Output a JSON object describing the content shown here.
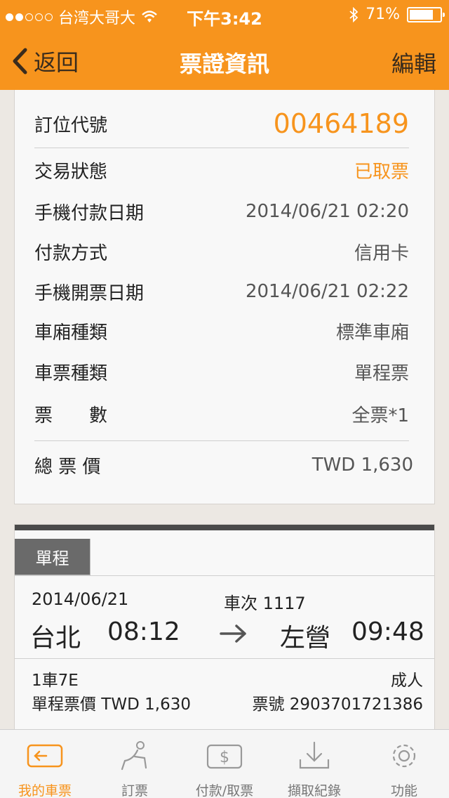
{
  "status_bar": {
    "carrier": "台湾大哥大",
    "time": "下午3:42",
    "battery": "71%",
    "battery_level": 0.71
  },
  "nav": {
    "back_label": "返回",
    "title": "票證資訊",
    "edit_label": "編輯"
  },
  "ticket_info": {
    "booking_code_label": "訂位代號",
    "booking_code": "00464189",
    "rows": [
      {
        "label": "交易狀態",
        "value": "已取票"
      },
      {
        "label": "手機付款日期",
        "value": "2014/06/21 02:20"
      },
      {
        "label": "付款方式",
        "value": "信用卡"
      },
      {
        "label": "手機開票日期",
        "value": "2014/06/21 02:22"
      },
      {
        "label": "車廂種類",
        "value": "標準車廂"
      },
      {
        "label": "車票種類",
        "value": "單程票"
      },
      {
        "label": "票　　數",
        "value": "全票*1"
      }
    ],
    "total_label": "總 票 價",
    "total_value": "TWD 1,630"
  },
  "trip": {
    "tag": "單程",
    "date": "2014/06/21",
    "train": "車次 1117",
    "from": "台北",
    "departure": "08:12",
    "to": "左營",
    "arrival": "09:48",
    "seat": "1車7E",
    "passenger_type": "成人",
    "price": "單程票價 TWD 1,630",
    "ticket_no": "票號 2903701721386"
  },
  "tabbar": {
    "items": [
      {
        "label": "我的車票",
        "icon": "ticket-icon",
        "active": true
      },
      {
        "label": "訂票",
        "icon": "seat-icon",
        "active": false
      },
      {
        "label": "付款/取票",
        "icon": "payment-icon",
        "active": false
      },
      {
        "label": "擷取紀錄",
        "icon": "download-icon",
        "active": false
      },
      {
        "label": "功能",
        "icon": "gear-icon",
        "active": false
      }
    ]
  },
  "colors": {
    "accent": "#f7941d",
    "nav_text_dark": "#3a2c1d"
  }
}
